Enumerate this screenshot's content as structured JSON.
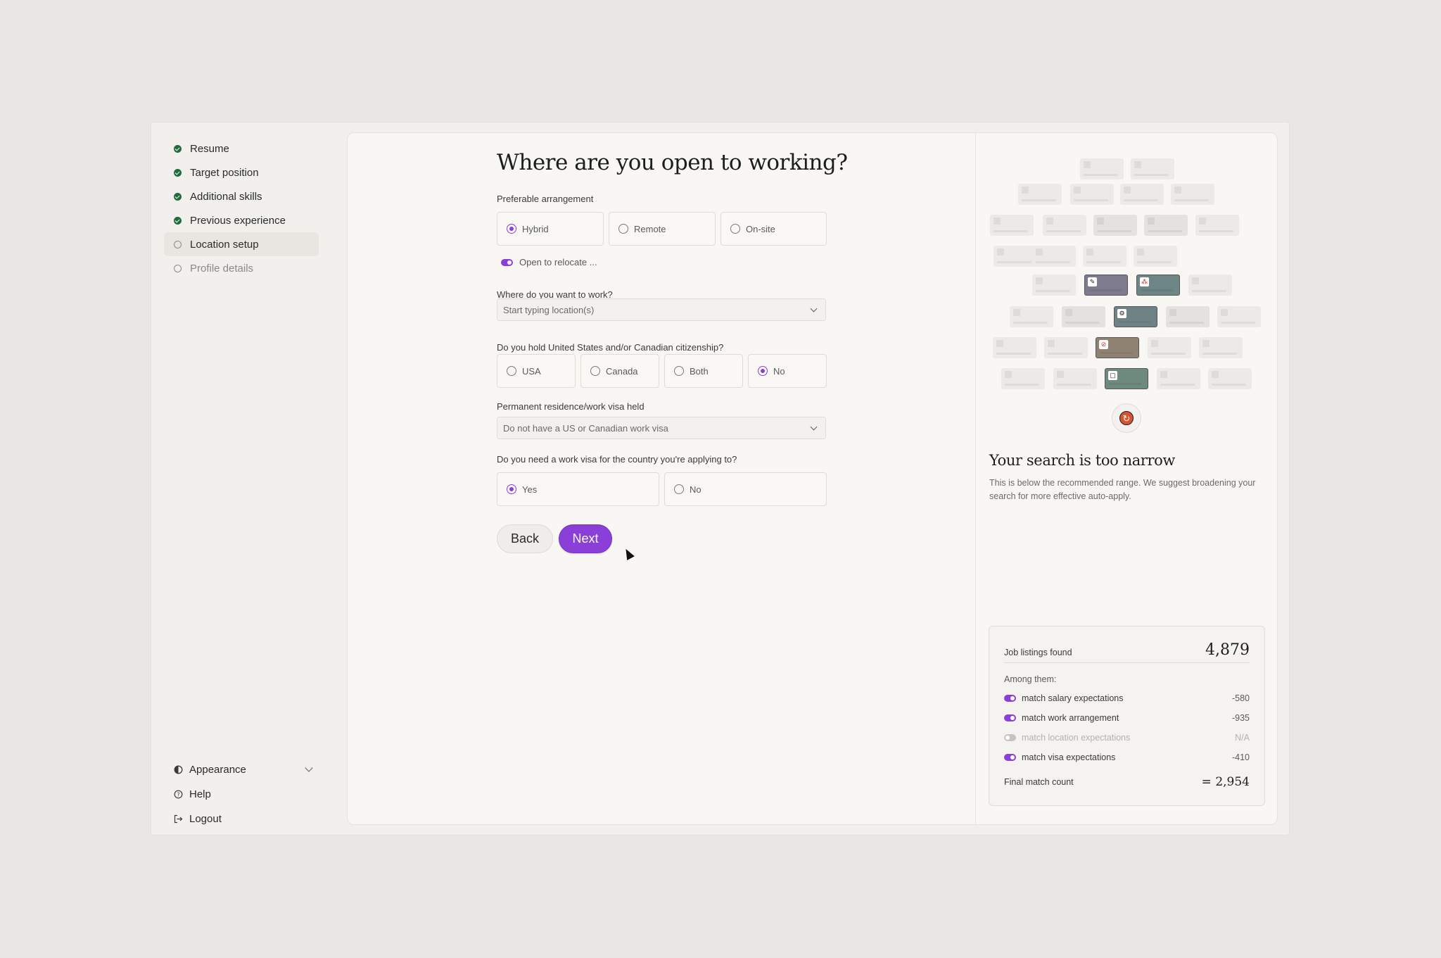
{
  "steps": [
    {
      "label": "Resume",
      "status": "done"
    },
    {
      "label": "Target position",
      "status": "done"
    },
    {
      "label": "Additional skills",
      "status": "done"
    },
    {
      "label": "Previous experience",
      "status": "done"
    },
    {
      "label": "Location setup",
      "status": "current"
    },
    {
      "label": "Profile details",
      "status": "todo"
    }
  ],
  "sidebar_bottom": {
    "appearance": "Appearance",
    "help": "Help",
    "logout": "Logout"
  },
  "form": {
    "title": "Where are you open to working?",
    "arrangement": {
      "label": "Preferable arrangement",
      "options": [
        "Hybrid",
        "Remote",
        "On-site"
      ],
      "selected": "Hybrid"
    },
    "relocate": {
      "label": "Open to relocate ...",
      "on": true
    },
    "where": {
      "label": "Where do you want to work?",
      "placeholder": "Start typing location(s)"
    },
    "citizenship": {
      "label": "Do you hold United States and/or Canadian citizenship?",
      "options": [
        "USA",
        "Canada",
        "Both",
        "No"
      ],
      "selected": "No"
    },
    "residence": {
      "label": "Permanent residence/work visa held",
      "value": "Do not have a US or Canadian work visa"
    },
    "need_visa": {
      "label": "Do you need a work visa for the country you're applying to?",
      "options": [
        "Yes",
        "No"
      ],
      "selected": "Yes"
    },
    "back_label": "Back",
    "next_label": "Next"
  },
  "result": {
    "title": "Your search is too narrow",
    "description": "This is below the recommended range. We suggest broadening your search for more effective auto-apply.",
    "job_listings_label": "Job listings found",
    "job_listings_value": "4,879",
    "among_label": "Among them:",
    "filters": [
      {
        "label": "match salary expectations",
        "value": "-580",
        "on": true
      },
      {
        "label": "match work arrangement",
        "value": "-935",
        "on": true
      },
      {
        "label": "match location expectations",
        "value": "N/A",
        "on": false
      },
      {
        "label": "match visa expectations",
        "value": "-410",
        "on": true
      }
    ],
    "final_label": "Final match count",
    "final_value": "= 2,954"
  },
  "colors": {
    "accent": "#8b3fd9",
    "done": "#1f6b3a",
    "refresh": "#d8532f"
  },
  "icons": {
    "done": "check-circle-icon",
    "appearance": "contrast-icon",
    "help": "help-circle-icon",
    "logout": "logout-icon",
    "refresh": "refresh-icon"
  }
}
